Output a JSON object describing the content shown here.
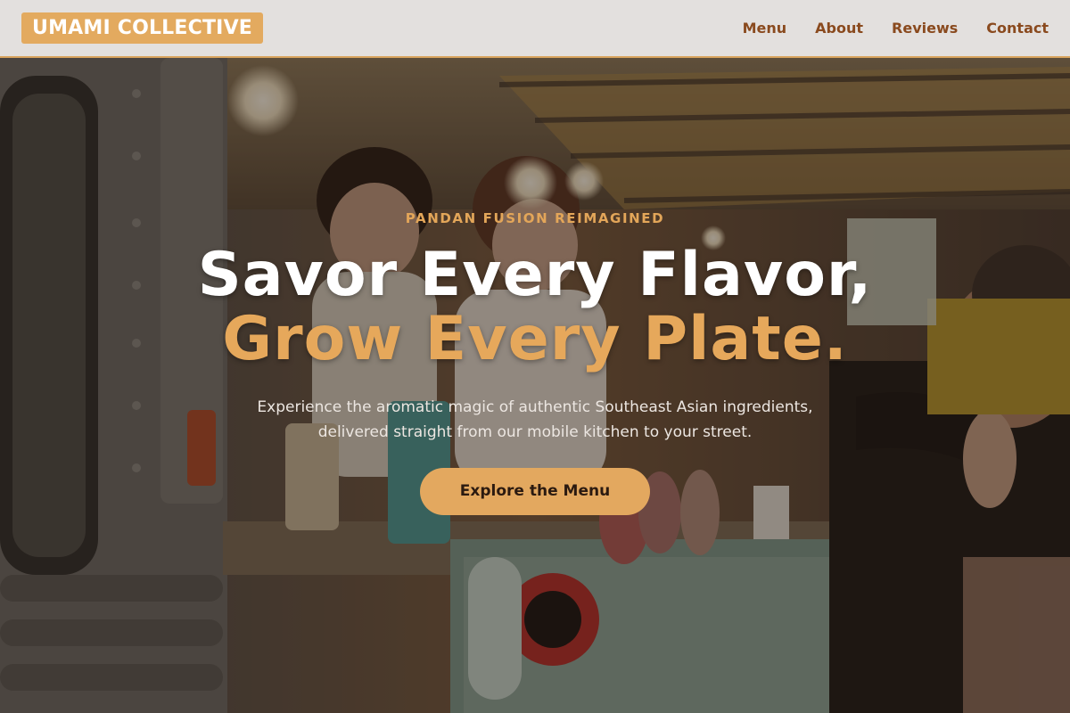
{
  "header": {
    "logo_text": "UMAMI COLLECTIVE",
    "nav": [
      {
        "label": "Menu"
      },
      {
        "label": "About"
      },
      {
        "label": "Reviews"
      },
      {
        "label": "Contact"
      }
    ]
  },
  "hero": {
    "eyebrow": "PANDAN FUSION REIMAGINED",
    "headline_line1": "Savor Every Flavor,",
    "headline_line2": "Grow Every Plate.",
    "subtext_line1": "Experience the aromatic magic of authentic Southeast Asian ingredients,",
    "subtext_line2": "delivered straight from our mobile kitchen to your street.",
    "cta_label": "Explore the Menu",
    "background": "food-truck-photo"
  },
  "colors": {
    "accent": "#e3aa5f",
    "nav_text": "#8a4a1e",
    "header_bg": "#e3e0de",
    "cta_text": "#2b1a10"
  }
}
